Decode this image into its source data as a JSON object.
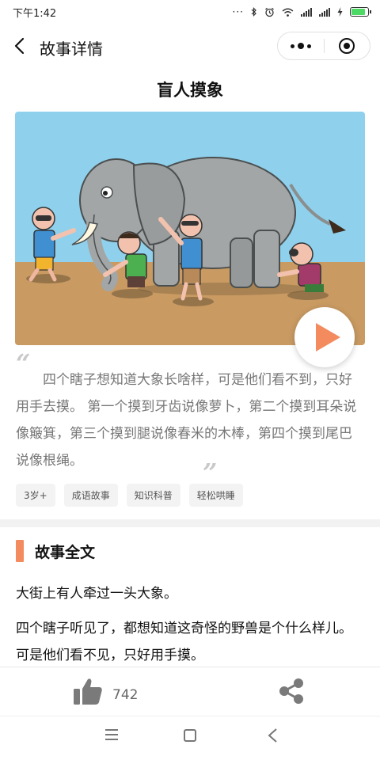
{
  "status_bar": {
    "time": "下午1:42",
    "icons": [
      "dots-icon",
      "bluetooth-icon",
      "alarm-icon",
      "wifi-icon",
      "signal-icon",
      "signal-icon",
      "charging-icon",
      "battery-icon"
    ],
    "battery_level": 0.85
  },
  "nav": {
    "title": "故事详情"
  },
  "story": {
    "title": "盲人摸象",
    "summary": "四个瞎子想知道大象长啥样，可是他们看不到，只好用手去摸。 第一个摸到牙齿说像萝卜，第二个摸到耳朵说像簸箕，第三个摸到腿说像春米的木棒，第四个摸到尾巴说像根绳。",
    "tags": [
      "3岁+",
      "成语故事",
      "知识科普",
      "轻松哄睡"
    ]
  },
  "fulltext": {
    "section_title": "故事全文",
    "paragraphs": [
      "大街上有人牵过一头大象。",
      "四个瞎子听见了，都想知道这奇怪的野兽是个什么样儿。可是他们看不见，只好用手摸。"
    ]
  },
  "bottom_bar": {
    "like_count": "742"
  },
  "colors": {
    "accent": "#f38b5f",
    "sky": "#8fd0ec",
    "ground": "#c99a62",
    "elephant": "#a3a6a6"
  }
}
